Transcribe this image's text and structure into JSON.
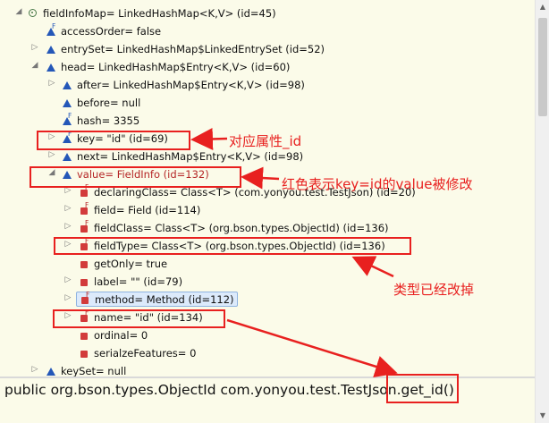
{
  "variables_tree": {
    "rows": [
      {
        "label": "fieldInfoMap= LinkedHashMap<K,V>  (id=45)"
      },
      {
        "label": "accessOrder= false"
      },
      {
        "label": "entrySet= LinkedHashMap$LinkedEntrySet  (id=52)"
      },
      {
        "label": "head= LinkedHashMap$Entry<K,V>  (id=60)"
      },
      {
        "label": "after= LinkedHashMap$Entry<K,V>  (id=98)"
      },
      {
        "label": "before= null"
      },
      {
        "label": "hash= 3355"
      },
      {
        "label": "key= \"id\" (id=69)"
      },
      {
        "label": "next= LinkedHashMap$Entry<K,V>  (id=98)"
      },
      {
        "label": "value= FieldInfo  (id=132)"
      },
      {
        "label": "declaringClass= Class<T> (com.yonyou.test.TestJson) (id=20)"
      },
      {
        "label": "field= Field  (id=114)"
      },
      {
        "label": "fieldClass= Class<T> (org.bson.types.ObjectId) (id=136)"
      },
      {
        "label": "fieldType= Class<T> (org.bson.types.ObjectId) (id=136)"
      },
      {
        "label": "getOnly= true"
      },
      {
        "label": "label= \"\" (id=79)"
      },
      {
        "label": "method= Method  (id=112)"
      },
      {
        "label": "name= \"id\" (id=134)"
      },
      {
        "label": "ordinal= 0"
      },
      {
        "label": "serialzeFeatures= 0"
      },
      {
        "label": "keySet= null"
      }
    ]
  },
  "detail_pane": {
    "text": "public org.bson.types.ObjectId com.yonyou.test.TestJson.get_id()"
  },
  "annotations": {
    "key_note": "对应属性_id",
    "value_note": "红色表示key=id的value被修改",
    "fieldtype_note": "类型已经改掉"
  },
  "colors": {
    "annotation_red": "#e8201f",
    "pane_background": "#fbfbe9",
    "selection_background": "#dceafb"
  }
}
